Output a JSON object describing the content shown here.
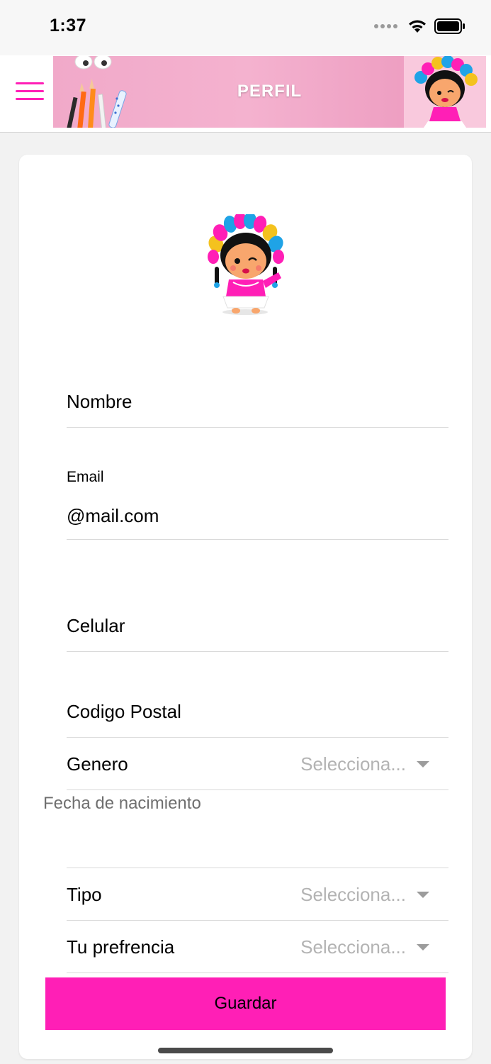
{
  "status_bar": {
    "time": "1:37"
  },
  "header": {
    "title": "PERFIL",
    "menu_icon": "hamburger-menu-icon"
  },
  "form": {
    "nombre_label": "Nombre",
    "email_label": "Email",
    "email_value": "@mail.com",
    "celular_label": "Celular",
    "codigo_postal_label": "Codigo Postal",
    "genero_label": "Genero",
    "genero_value": "Selecciona...",
    "fecha_label": "Fecha de nacimiento",
    "tipo_label": "Tipo",
    "tipo_value": "Selecciona...",
    "preferencia_label": "Tu prefrencia",
    "preferencia_value": "Selecciona...",
    "save_label": "Guardar"
  },
  "colors": {
    "accent": "#ff1fb6",
    "banner_pink": "#f1a9c9",
    "placeholder": "#b3b3b3"
  }
}
